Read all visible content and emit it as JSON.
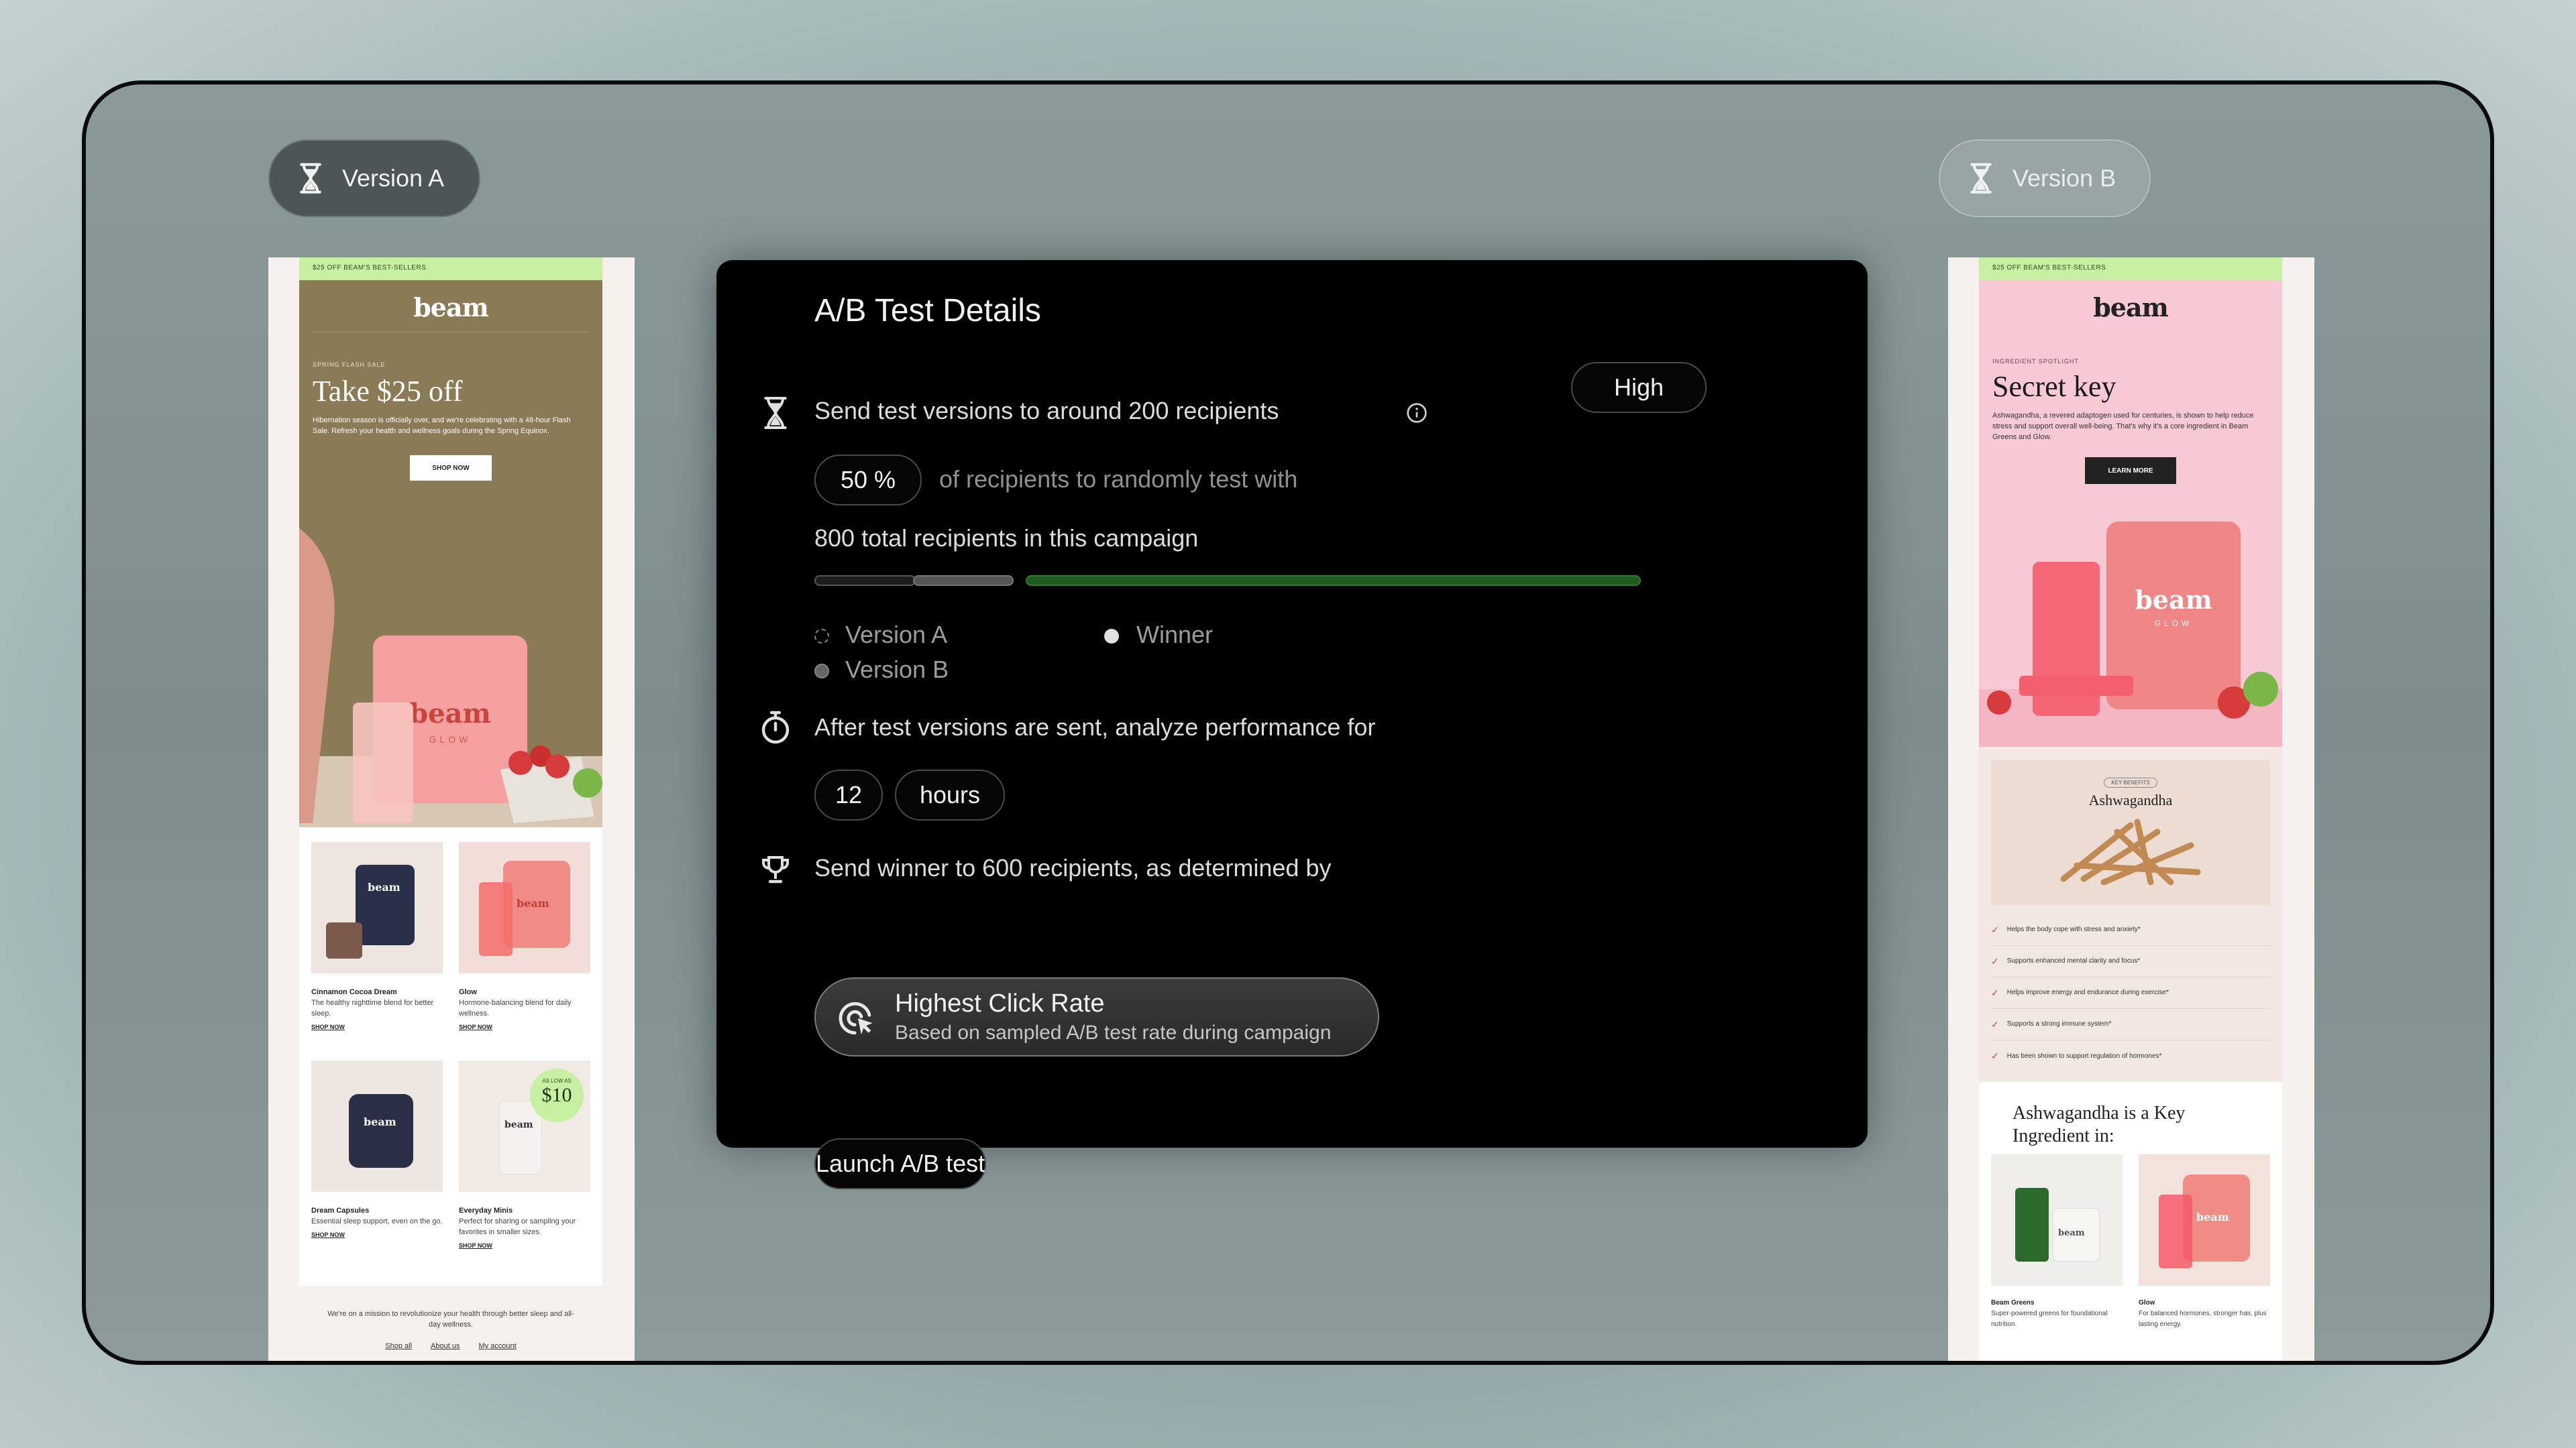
{
  "version_a": {
    "label": "Version A"
  },
  "version_b": {
    "label": "Version B"
  },
  "email_a": {
    "banner": "$25 OFF BEAM'S BEST-SELLERS",
    "logo": "beam",
    "eyebrow": "SPRING FLASH SALE",
    "headline": "Take $25 off",
    "body": "Hibernation season is officially over, and we're celebrating with a 48-hour Flash Sale. Refresh your health and wellness goals during the Spring Equinox.",
    "cta": "SHOP NOW",
    "hero_brand": "beam",
    "hero_sub": "GLOW",
    "products": [
      {
        "name": "Cinnamon Cocoa Dream",
        "desc": "The healthy nighttime blend for better sleep.",
        "link": "SHOP NOW",
        "color": "#2a2f4a",
        "bg": "#eee5e0",
        "brand": "beam"
      },
      {
        "name": "Glow",
        "desc": "Hormone-balancing blend for daily wellness.",
        "link": "SHOP NOW",
        "color": "#f08b86",
        "bg": "#f2ddd8",
        "brand": "beam"
      },
      {
        "name": "Dream Capsules",
        "desc": "Essential sleep support, even on the go.",
        "link": "SHOP NOW",
        "color": "#2b2f45",
        "bg": "#eee6e0",
        "brand": "beam"
      },
      {
        "name": "Everyday Minis",
        "desc": "Perfect for sharing or sampling your favorites in smaller sizes.",
        "link": "SHOP NOW",
        "color": "#f4f1ee",
        "bg": "#f1e9e3",
        "brand": "beam"
      }
    ],
    "badge_small": "AS LOW AS",
    "badge_price": "$10",
    "footer_text": "We're on a mission to revolutionize your health through better sleep and all-day wellness.",
    "footer_links": [
      "Shop all",
      "About us",
      "My account"
    ]
  },
  "email_b": {
    "banner": "$25 OFF BEAM'S BEST-SELLERS",
    "logo": "beam",
    "eyebrow": "INGREDIENT SPOTLIGHT",
    "headline": "Secret key",
    "body": "Ashwagandha, a revered adaptogen used for centuries, is shown to help reduce stress and support overall well-being. That's why it's a core ingredient in Beam Greens and Glow.",
    "cta": "LEARN MORE",
    "hero_brand": "beam",
    "hero_sub": "GLOW",
    "benefits_tag": "KEY BENEFITS",
    "benefits_title": "Ashwagandha",
    "benefits": [
      "Helps the body cope with stress and anxiety*",
      "Supports enhanced mental clarity and focus*",
      "Helps improve energy and endurance during exercise*",
      "Supports a strong immune system*",
      "Has been shown to support regulation of hormones*"
    ],
    "key_title": "Ashwagandha is a Key Ingredient in:",
    "products": [
      {
        "name": "Beam Greens",
        "desc": "Super-powered greens for foundational nutrition.",
        "brand": "beam"
      },
      {
        "name": "Glow",
        "desc": "For balanced hormones, stronger hair, plus lasting energy.",
        "brand": "beam"
      }
    ]
  },
  "panel": {
    "title": "A/B Test Details",
    "send_test_text": "Send test versions to around 200 recipients",
    "confidence": "High",
    "percent": "50 %",
    "percent_suffix": "of recipients to randomly test with",
    "total_text": "800 total recipients in this campaign",
    "split": {
      "version_a_pct": 12.5,
      "version_b_pct": 12.5,
      "winner_pct": 75
    },
    "legend": {
      "version_a": "Version A",
      "version_b": "Version B",
      "winner": "Winner"
    },
    "analyze_text": "After test versions are sent, analyze performance for",
    "duration_value": "12",
    "duration_unit": "hours",
    "winner_text": "Send winner to 600 recipients, as determined by",
    "criteria_title": "Highest Click Rate",
    "criteria_sub": "Based on sampled A/B test rate during campaign",
    "launch_label": "Launch A/B test"
  },
  "colors": {
    "winner_bar": "#1f5a1f",
    "banner_green": "#c8f0a2",
    "hero_a": "#8b7a56",
    "hero_b": "#f7c9d4"
  }
}
